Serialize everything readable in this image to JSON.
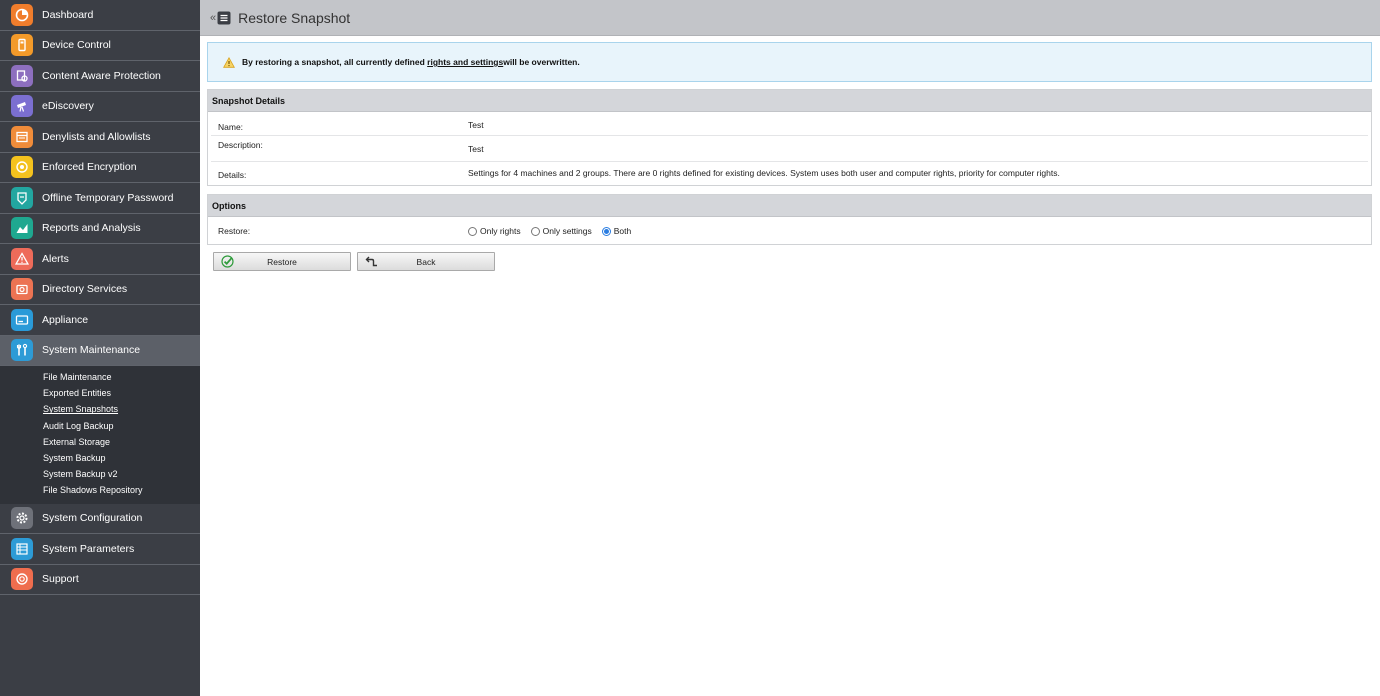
{
  "sidebar": {
    "items": [
      {
        "label": "Dashboard",
        "icon": "dashboard-icon",
        "color": "#f07d2c"
      },
      {
        "label": "Device Control",
        "icon": "device-control-icon",
        "color": "#f39a2a"
      },
      {
        "label": "Content Aware Protection",
        "icon": "content-aware-icon",
        "color": "#8d6fbf"
      },
      {
        "label": "eDiscovery",
        "icon": "ediscovery-icon",
        "color": "#7b6fd1"
      },
      {
        "label": "Denylists and Allowlists",
        "icon": "denylist-icon",
        "color": "#f08c3a"
      },
      {
        "label": "Enforced Encryption",
        "icon": "encryption-icon",
        "color": "#f4c21e"
      },
      {
        "label": "Offline Temporary Password",
        "icon": "password-icon",
        "color": "#22a6a0"
      },
      {
        "label": "Reports and Analysis",
        "icon": "reports-icon",
        "color": "#1fa890"
      },
      {
        "label": "Alerts",
        "icon": "alert-icon",
        "color": "#ee6b5a"
      },
      {
        "label": "Directory Services",
        "icon": "directory-icon",
        "color": "#ec7353"
      },
      {
        "label": "Appliance",
        "icon": "appliance-icon",
        "color": "#2a9ad8"
      },
      {
        "label": "System Maintenance",
        "icon": "maintenance-icon",
        "color": "#2d9bd6"
      }
    ],
    "subitems": [
      "File Maintenance",
      "Exported Entities",
      "System Snapshots",
      "Audit Log Backup",
      "External Storage",
      "System Backup",
      "System Backup v2",
      "File Shadows Repository"
    ],
    "bottom_items": [
      {
        "label": "System Configuration",
        "icon": "gear-icon",
        "color": "#6e7179"
      },
      {
        "label": "System Parameters",
        "icon": "parameters-icon",
        "color": "#2d9bd6"
      },
      {
        "label": "Support",
        "icon": "support-icon",
        "color": "#ef6d4e"
      }
    ]
  },
  "header": {
    "title": "Restore Snapshot",
    "collapse_glyph": "«"
  },
  "alert": {
    "text_before": "By restoring a snapshot, all currently defined ",
    "link": "rights and settings",
    "text_after": " will be overwritten."
  },
  "details": {
    "title": "Snapshot Details",
    "name_label": "Name:",
    "name_value": "Test",
    "description_label": "Description:",
    "description_value": "Test",
    "details_label": "Details:",
    "details_value": "Settings for 4 machines and 2 groups. There are 0 rights defined for existing devices. System uses both user and computer rights, priority for computer rights."
  },
  "options": {
    "title": "Options",
    "restore_label": "Restore:",
    "choices": [
      "Only rights",
      "Only settings",
      "Both"
    ],
    "selected": "Both"
  },
  "buttons": {
    "restore": "Restore",
    "back": "Back"
  },
  "colors": {
    "accent": "#2a7de1",
    "sidebar_bg": "#3b3e45",
    "alert_bg": "#e8f4fb"
  }
}
